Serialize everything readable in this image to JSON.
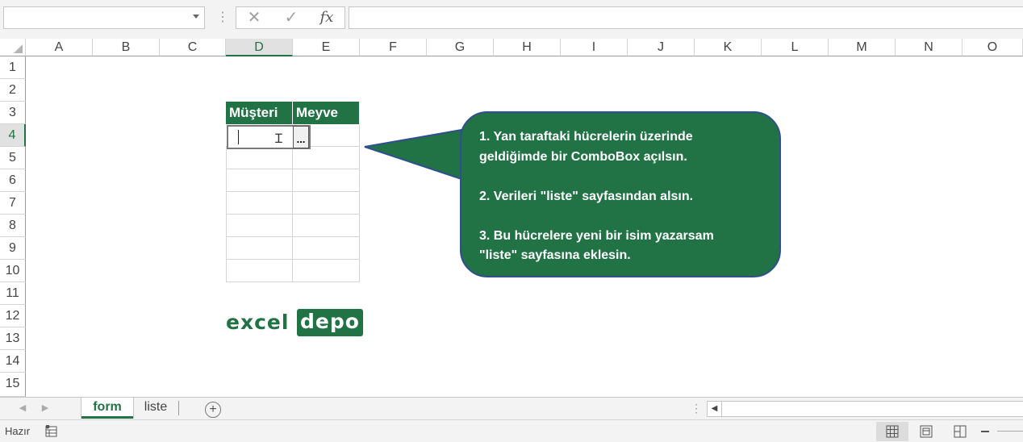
{
  "formula_bar": {
    "name_box_value": "",
    "separator_glyph": "⋮",
    "cancel_glyph": "✕",
    "enter_glyph": "✓",
    "fx_label": "fx",
    "formula_value": ""
  },
  "columns": [
    "A",
    "B",
    "C",
    "D",
    "E",
    "F",
    "G",
    "H",
    "I",
    "J",
    "K",
    "L",
    "M",
    "N",
    "O"
  ],
  "rows": [
    "1",
    "2",
    "3",
    "4",
    "5",
    "6",
    "7",
    "8",
    "9",
    "10",
    "11",
    "12",
    "13",
    "14",
    "15"
  ],
  "active_cell": {
    "column": "D",
    "row": "4",
    "value": ""
  },
  "table": {
    "headers": [
      "Müşteri",
      "Meyve"
    ],
    "dropdown_button_label": "..."
  },
  "callout": {
    "lines": [
      "1. Yan taraftaki hücrelerin üzerinde",
      "geldiğimde bir ComboBox açılsın.",
      "",
      "2. Verileri \"liste\" sayfasından alsın.",
      "",
      "3. Bu hücrelere yeni bir isim yazarsam",
      "\"liste\" sayfasına eklesin."
    ]
  },
  "logo": {
    "part1": "excel",
    "part2": "depo"
  },
  "sheet_tabs": {
    "prev_glyph": "◀",
    "next_glyph": "▶",
    "tabs": [
      {
        "label": "form",
        "active": true
      },
      {
        "label": "liste",
        "active": false
      }
    ],
    "add_glyph": "+",
    "dots_glyph": "⋮",
    "scroll_left_glyph": "◀"
  },
  "status_bar": {
    "status": "Hazır",
    "views": [
      "normal-view",
      "page-layout-view",
      "page-break-view"
    ],
    "active_view": "normal-view"
  },
  "colors": {
    "accent": "#217346",
    "callout_border": "#2f4f8f",
    "header_text": "#ffffff"
  }
}
